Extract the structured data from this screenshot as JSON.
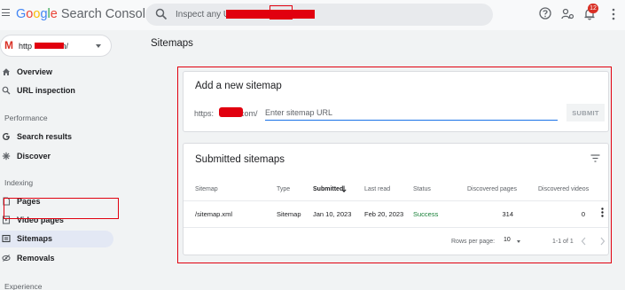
{
  "app": {
    "logo_letters": [
      "G",
      "o",
      "o",
      "g",
      "l",
      "e"
    ],
    "product": "Search Console"
  },
  "search": {
    "placeholder": "Inspect any UR"
  },
  "notifications": {
    "count": "12"
  },
  "colors": {
    "accent": "#1a73e8",
    "success": "#188038",
    "annotation": "#e1000f",
    "badge": "#d93025"
  },
  "property": {
    "icon_letter": "M",
    "url_start": "http",
    "url_end": "m/"
  },
  "sidebar": {
    "items": [
      {
        "label": "Overview",
        "icon": "home-icon"
      },
      {
        "label": "URL inspection",
        "icon": "search-icon"
      },
      {
        "label": "Search results",
        "icon": "google-g-icon"
      },
      {
        "label": "Discover",
        "icon": "asterisk-icon"
      },
      {
        "label": "Pages",
        "icon": "page-icon"
      },
      {
        "label": "Video pages",
        "icon": "video-page-icon"
      },
      {
        "label": "Sitemaps",
        "icon": "sitemap-icon",
        "active": true
      },
      {
        "label": "Removals",
        "icon": "removals-icon"
      }
    ],
    "sections": {
      "performance": "Performance",
      "indexing": "Indexing",
      "experience": "Experience"
    }
  },
  "main": {
    "title": "Sitemaps",
    "add_card": {
      "title": "Add a new sitemap",
      "prefix_start": "https:",
      "prefix_end": "com/",
      "input_placeholder": "Enter sitemap URL",
      "submit_label": "SUBMIT"
    },
    "list_card": {
      "title": "Submitted sitemaps",
      "columns": [
        "Sitemap",
        "Type",
        "Submitted",
        "Last read",
        "Status",
        "Discovered pages",
        "Discovered videos"
      ],
      "rows": [
        {
          "sitemap": "/sitemap.xml",
          "type": "Sitemap",
          "submitted": "Jan 10, 2023",
          "last_read": "Feb 20, 2023",
          "status": "Success",
          "pages": "314",
          "videos": "0"
        }
      ],
      "pager": {
        "rows_per_page_label": "Rows per page:",
        "rows_per_page": "10",
        "range": "1-1 of 1"
      }
    }
  }
}
